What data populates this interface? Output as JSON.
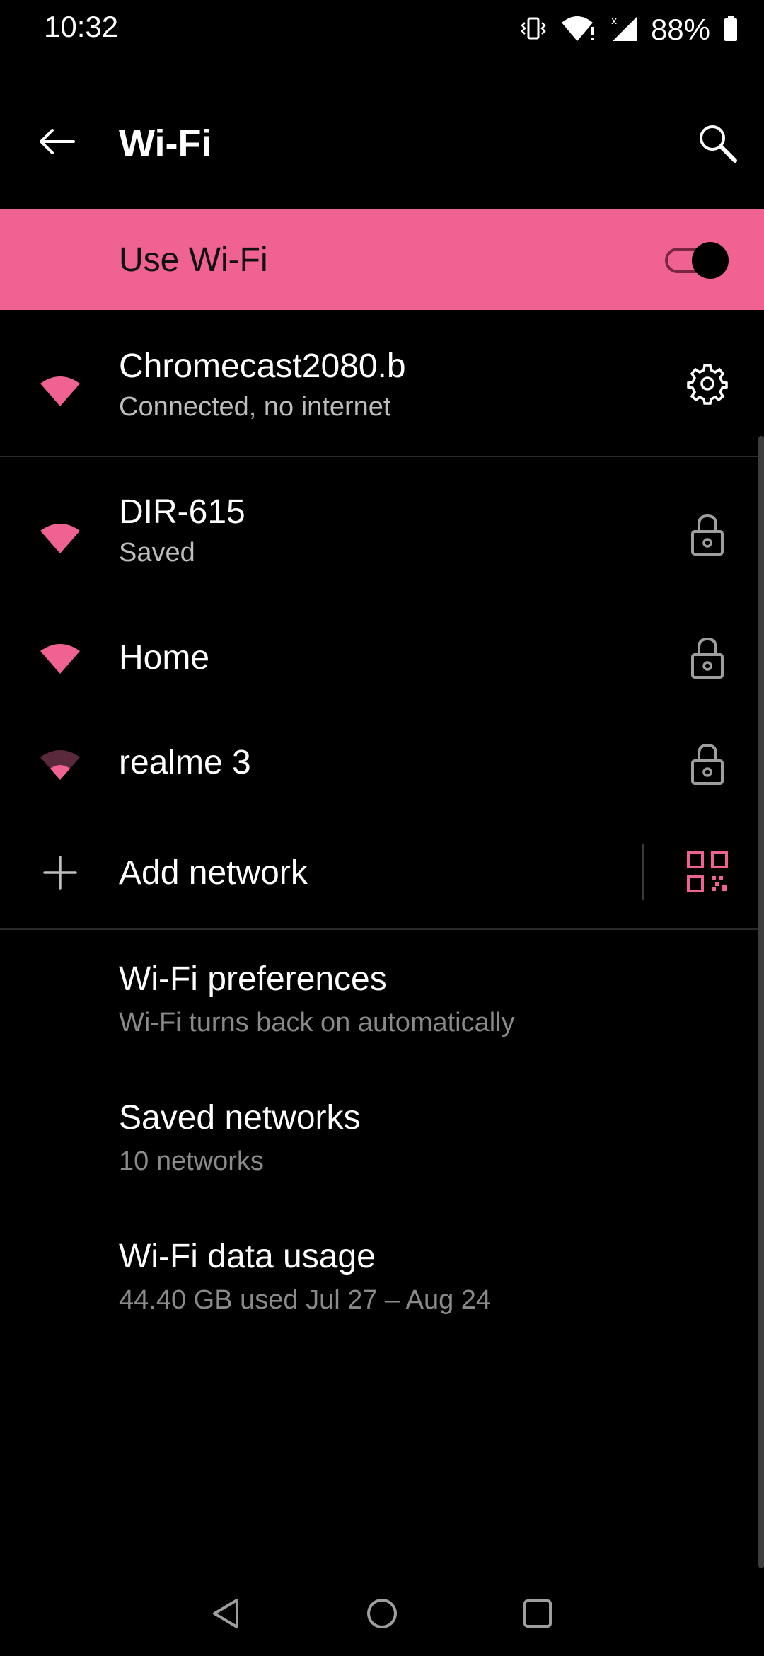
{
  "status_bar": {
    "time": "10:32",
    "battery": "88%"
  },
  "app_bar": {
    "title": "Wi-Fi"
  },
  "use_wifi": {
    "label": "Use Wi-Fi",
    "enabled": true
  },
  "connected": {
    "name": "Chromecast2080.b",
    "status": "Connected, no internet"
  },
  "networks": [
    {
      "name": "DIR-615",
      "status": "Saved"
    },
    {
      "name": "Home"
    },
    {
      "name": "realme 3"
    }
  ],
  "add_network": {
    "label": "Add network"
  },
  "preferences": {
    "title": "Wi-Fi preferences",
    "subtitle": "Wi-Fi turns back on automatically"
  },
  "saved_networks": {
    "title": "Saved networks",
    "subtitle": "10 networks"
  },
  "data_usage": {
    "title": "Wi-Fi data usage",
    "subtitle": "44.40 GB used Jul 27 – Aug 24"
  },
  "colors": {
    "accent": "#F06292",
    "background": "#000000",
    "secondary_text": "#BDBDBD"
  }
}
